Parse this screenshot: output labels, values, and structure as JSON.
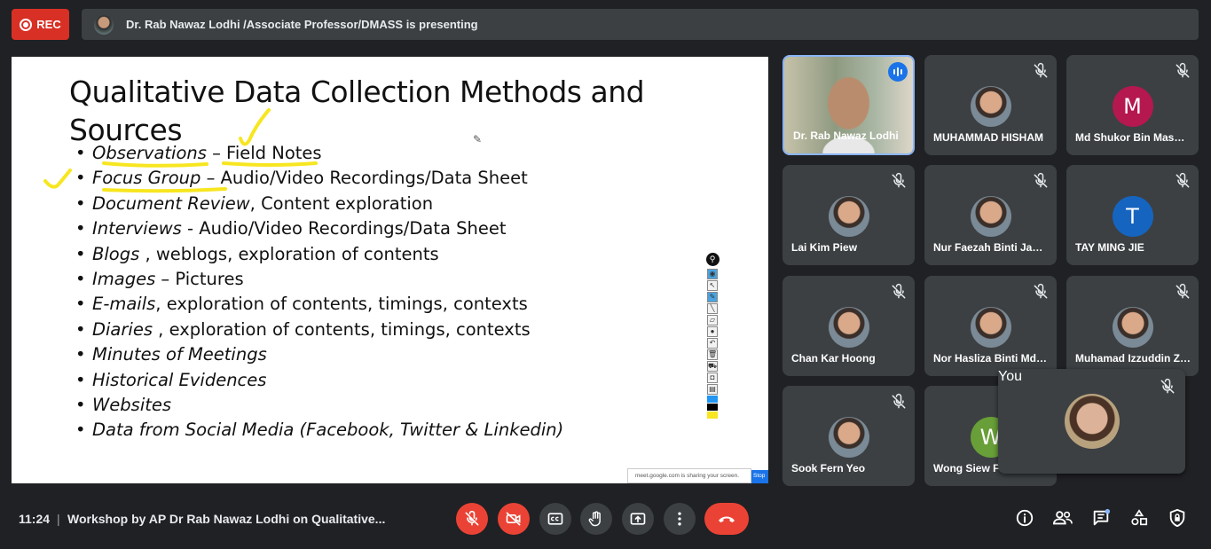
{
  "topbar": {
    "rec_label": "REC",
    "presenting_text": "Dr. Rab Nawaz Lodhi /Associate Professor/DMASS is presenting"
  },
  "slide": {
    "title": "Qualitative Data Collection Methods and Sources",
    "bullets": [
      {
        "italic": "Observations",
        "rest": " – Field Notes"
      },
      {
        "italic": "Focus Group",
        "rest": " – Audio/Video Recordings/Data Sheet"
      },
      {
        "italic": "Document Review",
        "rest": ", Content exploration"
      },
      {
        "italic": "Interviews",
        "rest": " - Audio/Video Recordings/Data Sheet"
      },
      {
        "italic": "Blogs",
        "rest": " , weblogs, exploration of contents"
      },
      {
        "italic": "Images",
        "rest": " – Pictures"
      },
      {
        "italic": "E-mails",
        "rest": ", exploration of contents, timings, contexts"
      },
      {
        "italic": "Diaries",
        "rest": " , exploration of contents, timings, contexts"
      },
      {
        "italic": "Minutes of Meetings",
        "rest": ""
      },
      {
        "italic": "Historical Evidences",
        "rest": ""
      },
      {
        "italic": "Websites",
        "rest": ""
      },
      {
        "italic": "Data from Social Media (Facebook, Twitter & Linkedin)",
        "rest": ""
      }
    ],
    "share_notice": "meet.google.com is sharing your screen.",
    "stop_label": "Stop",
    "highlight_color": "#f7e620"
  },
  "participants": [
    {
      "name": "Dr. Rab Nawaz Lodhi",
      "avatar": "camera",
      "speaking": true
    },
    {
      "name": "MUHAMMAD HISHAM",
      "avatar": "photo"
    },
    {
      "name": "Md Shukor Bin Masuod",
      "avatar": "letter",
      "letter": "M",
      "color": "#b5174f"
    },
    {
      "name": "Lai Kim Piew",
      "avatar": "photo"
    },
    {
      "name": "Nur Faezah Binti Jamal",
      "avatar": "photo"
    },
    {
      "name": "TAY MING JIE",
      "avatar": "letter",
      "letter": "T",
      "color": "#1565c0"
    },
    {
      "name": "Chan Kar Hoong",
      "avatar": "photo"
    },
    {
      "name": "Nor Hasliza Binti Md Saad",
      "avatar": "photo"
    },
    {
      "name": "Muhamad Izzuddin Zainudin",
      "avatar": "photo"
    },
    {
      "name": "Sook Fern Yeo",
      "avatar": "photo"
    },
    {
      "name": "Wong Siew Fan",
      "avatar": "letter",
      "letter": "W",
      "color": "#689f38"
    }
  ],
  "self_tile": {
    "label": "You"
  },
  "bottombar": {
    "time": "11:24",
    "separator": "|",
    "meeting_title": "Workshop by AP Dr Rab Nawaz Lodhi on Qualitative..."
  }
}
